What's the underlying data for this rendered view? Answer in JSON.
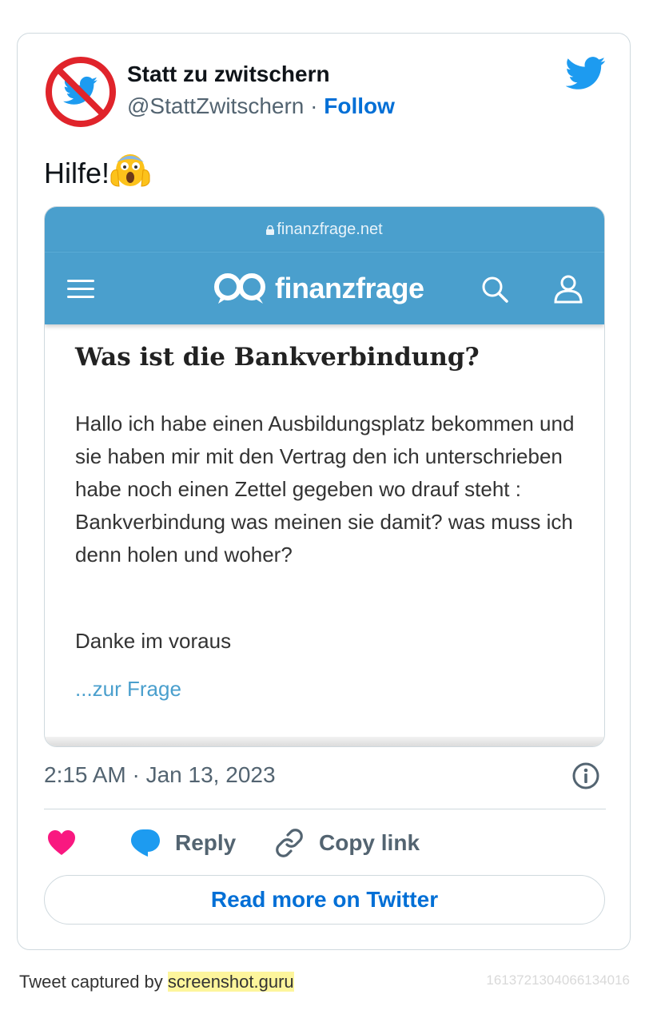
{
  "author": {
    "display_name": "Statt zu zwitschern",
    "handle": "@StattZwitschern",
    "separator": " · ",
    "follow_label": "Follow"
  },
  "tweet": {
    "text": "Hilfe!",
    "emoji": "face-screaming-in-fear-emoji"
  },
  "embed": {
    "url": "finanzfrage.net",
    "site_name": "finanzfrage",
    "question_title": "Was ist die Bankverbindung?",
    "question_body": "Hallo ich habe einen Ausbildungsplatz bekommen und sie haben mir mit den Vertrag den ich unterschrieben habe noch einen Zettel gegeben wo drauf steht : Bankverbindung was meinen sie damit? was muss ich denn holen und woher?",
    "thanks": "Danke im voraus",
    "link_label": "...zur Frage"
  },
  "meta": {
    "timestamp": "2:15 AM · Jan 13, 2023"
  },
  "actions": {
    "reply_label": "Reply",
    "copy_label": "Copy link"
  },
  "read_more_label": "Read more on Twitter",
  "footer": {
    "captured_by": "Tweet captured by ",
    "captured_link": "screenshot.guru",
    "tweet_id": "1613721304066134016"
  },
  "colors": {
    "accent": "#006fd6",
    "twitter_blue": "#1d9bf0",
    "like_pink": "#f91880",
    "site_blue": "#4a9fcd",
    "avatar_red": "#e0242b"
  }
}
